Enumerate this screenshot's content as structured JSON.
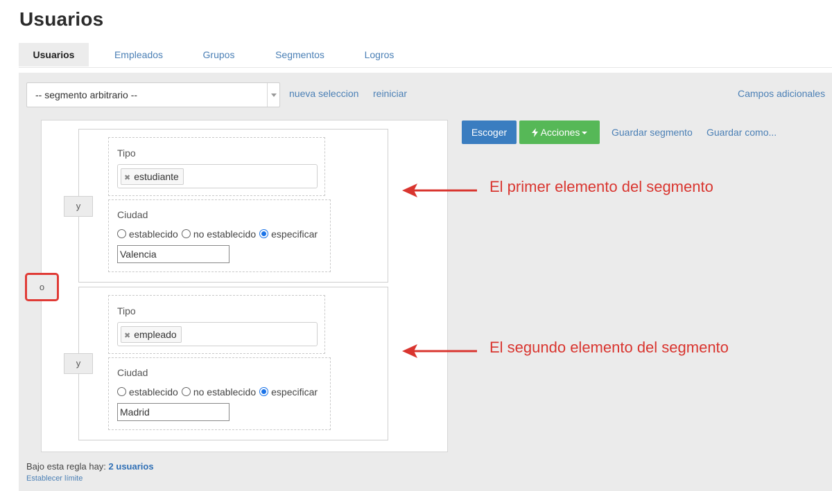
{
  "page": {
    "title": "Usuarios"
  },
  "tabs": [
    {
      "label": "Usuarios",
      "active": true
    },
    {
      "label": "Empleados"
    },
    {
      "label": "Grupos"
    },
    {
      "label": "Segmentos"
    },
    {
      "label": "Logros"
    }
  ],
  "toolbar": {
    "segment_select": "-- segmento arbitrario --",
    "new_selection": "nueva seleccion",
    "reset": "reiniciar",
    "extra_fields": "Campos adicionales"
  },
  "actions": {
    "choose": "Escoger",
    "actions": "Acciones",
    "save_segment": "Guardar segmento",
    "save_as": "Guardar como..."
  },
  "rule": {
    "or_operator": "o",
    "groups": [
      {
        "and_operator": "y",
        "type_label": "Tipo",
        "type_tag": "estudiante",
        "city_label": "Ciudad",
        "radio_options": [
          "establecido",
          "no establecido",
          "especificar"
        ],
        "selected_option": "especificar",
        "city_value": "Valencia"
      },
      {
        "and_operator": "y",
        "type_label": "Tipo",
        "type_tag": "empleado",
        "city_label": "Ciudad",
        "radio_options": [
          "establecido",
          "no establecido",
          "especificar"
        ],
        "selected_option": "especificar",
        "city_value": "Madrid"
      }
    ]
  },
  "annotations": {
    "first": "El primer elemento del segmento",
    "second": "El segundo elemento del segmento",
    "color": "#d9352f"
  },
  "footer": {
    "text": "Bajo esta regla hay:",
    "count": "2 usuarios",
    "limit_link": "Establecer límite"
  },
  "colors": {
    "primary": "#3a7dc0",
    "success": "#56b857",
    "link": "#4a7fb5"
  }
}
